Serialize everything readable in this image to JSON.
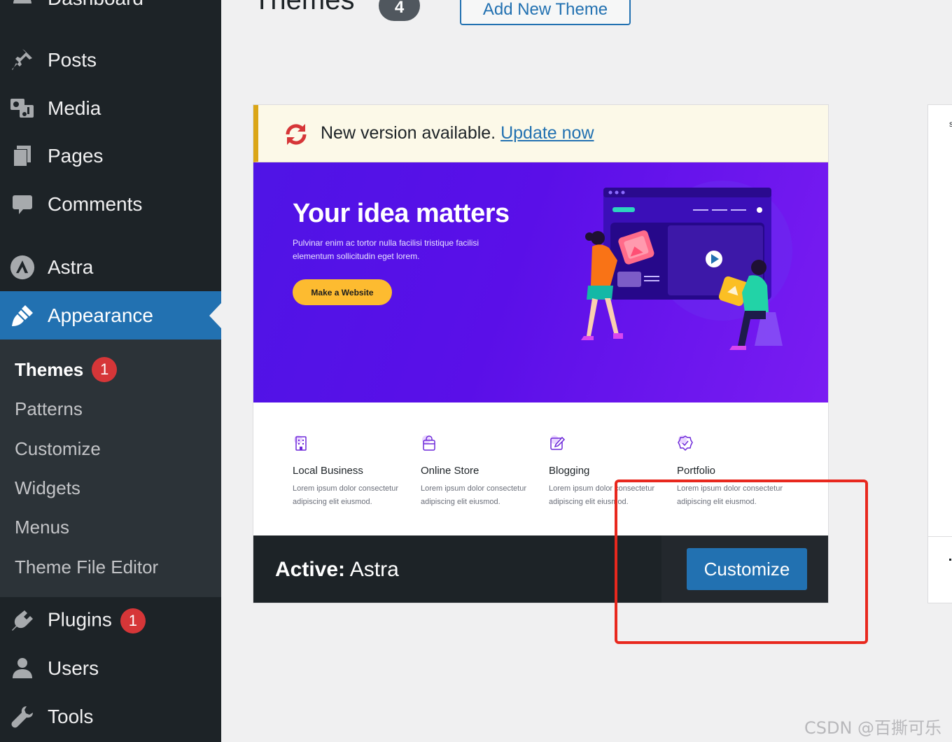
{
  "sidebar": {
    "items": [
      {
        "label": "Dashboard",
        "icon": "dashboard-icon"
      },
      {
        "label": "Posts",
        "icon": "pushpin-icon"
      },
      {
        "label": "Media",
        "icon": "media-icon"
      },
      {
        "label": "Pages",
        "icon": "pages-icon"
      },
      {
        "label": "Comments",
        "icon": "comment-icon"
      },
      {
        "label": "Astra",
        "icon": "astra-logo-icon"
      },
      {
        "label": "Appearance",
        "icon": "paintbrush-icon"
      },
      {
        "label": "Plugins",
        "icon": "plugin-icon",
        "badge": "1"
      },
      {
        "label": "Users",
        "icon": "user-icon"
      },
      {
        "label": "Tools",
        "icon": "wrench-icon"
      }
    ],
    "submenu": [
      {
        "label": "Themes",
        "badge": "1"
      },
      {
        "label": "Patterns"
      },
      {
        "label": "Customize"
      },
      {
        "label": "Widgets"
      },
      {
        "label": "Menus"
      },
      {
        "label": "Theme File Editor"
      }
    ]
  },
  "header": {
    "title": "Themes",
    "count": "4",
    "add_new_label": "Add New Theme"
  },
  "theme_card": {
    "update_notice": {
      "text": "New version available.",
      "link": "Update now"
    },
    "screenshot": {
      "hero_title": "Your idea matters",
      "hero_text": "Pulvinar enim ac tortor nulla facilisi tristique facilisi elementum sollicitudin eget lorem.",
      "cta_label": "Make a Website",
      "features": [
        {
          "title": "Local Business",
          "desc": "Lorem ipsum dolor consectetur adipiscing elit eiusmod.",
          "icon": "building-icon"
        },
        {
          "title": "Online Store",
          "desc": "Lorem ipsum dolor consectetur adipiscing elit eiusmod.",
          "icon": "shopping-bag-icon"
        },
        {
          "title": "Blogging",
          "desc": "Lorem ipsum dolor consectetur adipiscing elit eiusmod.",
          "icon": "edit-icon"
        },
        {
          "title": "Portfolio",
          "desc": "Lorem ipsum dolor consectetur adipiscing elit eiusmod.",
          "icon": "verified-badge-icon"
        }
      ]
    },
    "active_prefix": "Active:",
    "theme_name": "Astra",
    "customize_label": "Customize"
  },
  "next_card": {
    "letter": "s"
  },
  "watermark": "CSDN @百撕可乐",
  "colors": {
    "sidebar_bg": "#1d2327",
    "submenu_bg": "#2c3338",
    "accent": "#2271b1",
    "badge": "#d63638",
    "notice_border": "#dba617",
    "highlight": "#e8281e"
  }
}
